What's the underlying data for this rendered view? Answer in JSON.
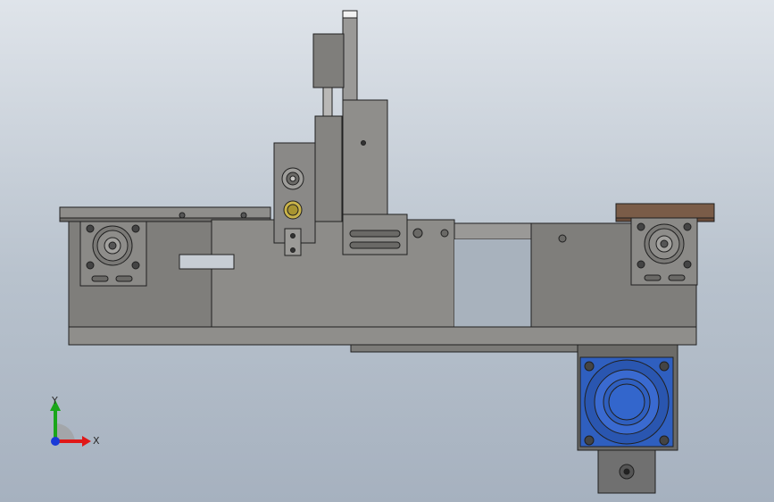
{
  "viewport": {
    "name": "graphics-area",
    "background_top": "#dfe4ea",
    "background_bottom": "#a6b1bf"
  },
  "model": {
    "body_color": "#8a8987",
    "body_dark": "#767572",
    "edge_color": "#202020",
    "motor_blue": "#2f5fbf",
    "motor_blue_dark": "#173a86",
    "wood_color": "#7a5c48",
    "connector_yellow": "#c9b34a"
  },
  "triad": {
    "x_label": "X",
    "y_label": "Y",
    "x_color": "#e01818",
    "y_color": "#1aa61a",
    "z_color": "#1a3ad8"
  }
}
